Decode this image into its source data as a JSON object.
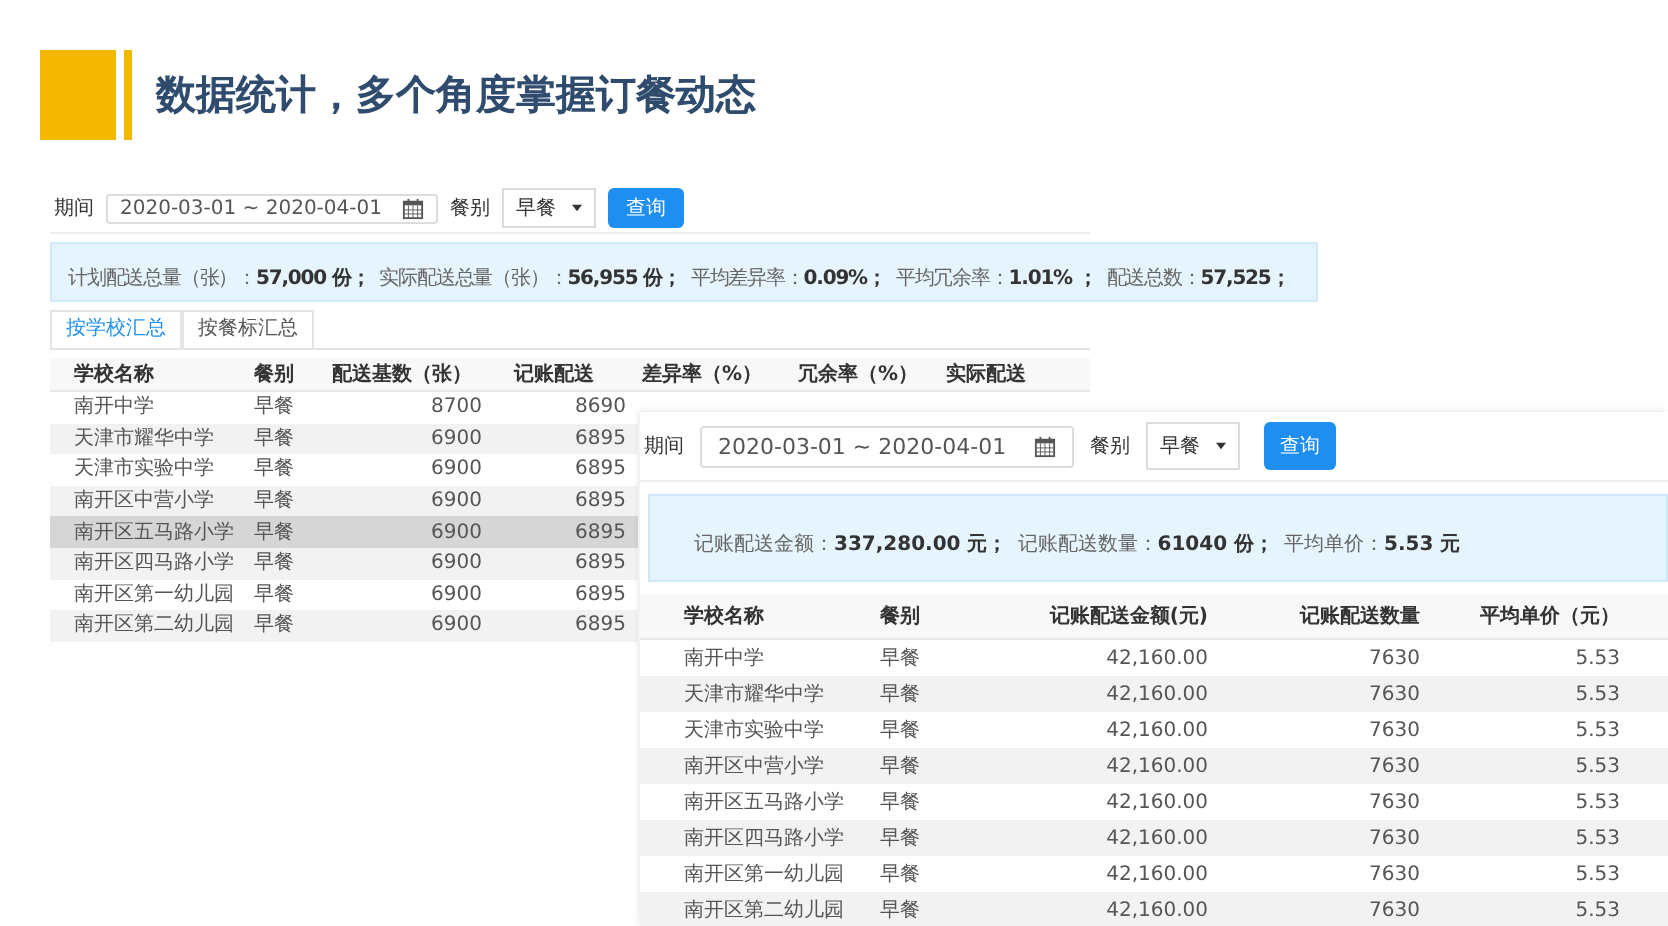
{
  "title": "数据统计，多个角度掌握订餐动态",
  "panels": [
    {
      "filters": {
        "period_label": "期间",
        "date_range": "2020-03-01 ~ 2020-04-01",
        "meal_label": "餐别",
        "meal_value": "早餐",
        "query_button": "查询"
      },
      "summary": [
        {
          "label": "计划配送总量（张）：",
          "value": "57,000 份；"
        },
        {
          "label": "实际配送总量（张）：",
          "value": "56,955 份；"
        },
        {
          "label": "平均差异率：",
          "value": "0.09%；"
        },
        {
          "label": "平均冗余率：",
          "value": "1.01% ；"
        },
        {
          "label": "配送总数：",
          "value": "57,525；"
        }
      ],
      "tabs": [
        {
          "label": "按学校汇总",
          "selected": true
        },
        {
          "label": "按餐标汇总",
          "selected": false
        }
      ],
      "table": {
        "columns": [
          "学校名称",
          "餐别",
          "配送基数（张）",
          "记账配送",
          "差异率（%）",
          "冗余率（%）",
          "实际配送"
        ],
        "rows": [
          {
            "cells": [
              "南开中学",
              "早餐",
              "8700",
              "8690"
            ],
            "selected": false
          },
          {
            "cells": [
              "天津市耀华中学",
              "早餐",
              "6900",
              "6895"
            ],
            "selected": false
          },
          {
            "cells": [
              "天津市实验中学",
              "早餐",
              "6900",
              "6895"
            ],
            "selected": false
          },
          {
            "cells": [
              "南开区中营小学",
              "早餐",
              "6900",
              "6895"
            ],
            "selected": false
          },
          {
            "cells": [
              "南开区五马路小学",
              "早餐",
              "6900",
              "6895"
            ],
            "selected": true
          },
          {
            "cells": [
              "南开区四马路小学",
              "早餐",
              "6900",
              "6895"
            ],
            "selected": false
          },
          {
            "cells": [
              "南开区第一幼儿园",
              "早餐",
              "6900",
              "6895"
            ],
            "selected": false
          },
          {
            "cells": [
              "南开区第二幼儿园",
              "早餐",
              "6900",
              "6895"
            ],
            "selected": false
          }
        ]
      }
    },
    {
      "filters": {
        "period_label": "期间",
        "date_range": "2020-03-01 ~ 2020-04-01",
        "meal_label": "餐别",
        "meal_value": "早餐",
        "query_button": "查询"
      },
      "summary": [
        {
          "label": "记账配送金额：",
          "value": "337,280.00 元；"
        },
        {
          "label": "记账配送数量：",
          "value": "61040  份；"
        },
        {
          "label": "平均单价：",
          "value": "5.53 元"
        }
      ],
      "table": {
        "columns": [
          "学校名称",
          "餐别",
          "记账配送金额(元)",
          "记账配送数量",
          "平均单价（元）"
        ],
        "rows": [
          {
            "cells": [
              "南开中学",
              "早餐",
              "42,160.00",
              "7630",
              "5.53"
            ]
          },
          {
            "cells": [
              "天津市耀华中学",
              "早餐",
              "42,160.00",
              "7630",
              "5.53"
            ]
          },
          {
            "cells": [
              "天津市实验中学",
              "早餐",
              "42,160.00",
              "7630",
              "5.53"
            ]
          },
          {
            "cells": [
              "南开区中营小学",
              "早餐",
              "42,160.00",
              "7630",
              "5.53"
            ]
          },
          {
            "cells": [
              "南开区五马路小学",
              "早餐",
              "42,160.00",
              "7630",
              "5.53"
            ]
          },
          {
            "cells": [
              "南开区四马路小学",
              "早餐",
              "42,160.00",
              "7630",
              "5.53"
            ]
          },
          {
            "cells": [
              "南开区第一幼儿园",
              "早餐",
              "42,160.00",
              "7630",
              "5.53"
            ]
          },
          {
            "cells": [
              "南开区第二幼儿园",
              "早餐",
              "42,160.00",
              "7630",
              "5.53"
            ]
          }
        ]
      }
    }
  ]
}
